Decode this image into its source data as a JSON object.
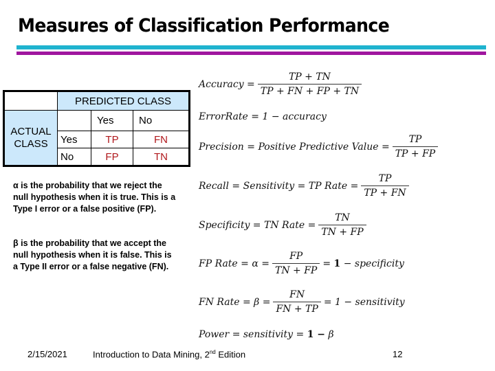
{
  "slide": {
    "title": "Measures of Classification Performance",
    "accent_colors": {
      "top_bar": "#1fb3cf",
      "bottom_bar": "#a0169f",
      "table_header_fill": "#cce8fb",
      "cell_value": "#b0181c"
    }
  },
  "confusion_matrix": {
    "predicted_header": "PREDICTED CLASS",
    "actual_header_line1": "ACTUAL",
    "actual_header_line2": "CLASS",
    "predicted_labels": [
      "Yes",
      "No"
    ],
    "actual_labels": [
      "Yes",
      "No"
    ],
    "cells": [
      [
        "TP",
        "FN"
      ],
      [
        "FP",
        "TN"
      ]
    ]
  },
  "notes": {
    "alpha_symbol": "α",
    "alpha_text": " is the probability that we reject the null hypothesis when it is true. This is a Type I error or a false positive (FP).",
    "beta_symbol": "β",
    "beta_text": " is the probability that we accept the null hypothesis when it is false. This is a Type II error or a false negative (FN)."
  },
  "formulas": {
    "accuracy": {
      "lhs": "Accuracy =",
      "num": "TP + TN",
      "den": "TP + FN + FP + TN"
    },
    "error_rate": {
      "text": "ErrorRate = 1 − accuracy"
    },
    "precision": {
      "lhs": "Precision = Positive Predictive Value =",
      "num": "TP",
      "den": "TP +  FP"
    },
    "recall": {
      "lhs": "Recall = Sensitivity = TP Rate =",
      "num": "TP",
      "den": "TP +  FN"
    },
    "specificity": {
      "lhs": "Specificity = TN Rate =",
      "num": "TN",
      "den": "TN + FP"
    },
    "fp_rate": {
      "lhs": "FP Rate =  α =",
      "num": "FP",
      "den": "TN +  FP",
      "eq": "=",
      "one": "1",
      "rhs": "− specificity"
    },
    "fn_rate": {
      "lhs": "FN Rate =  β =",
      "num": "FN",
      "den": "FN + TP",
      "rhs": "= 1 − sensitivity"
    },
    "power": {
      "lhs": "Power = sensitivity =",
      "one_minus": "1 −",
      "rhs": "β"
    }
  },
  "footer": {
    "date": "2/15/2021",
    "course_prefix": "Introduction to Data Mining, 2",
    "course_sup": "nd",
    "course_suffix": " Edition",
    "page_number": "12"
  }
}
